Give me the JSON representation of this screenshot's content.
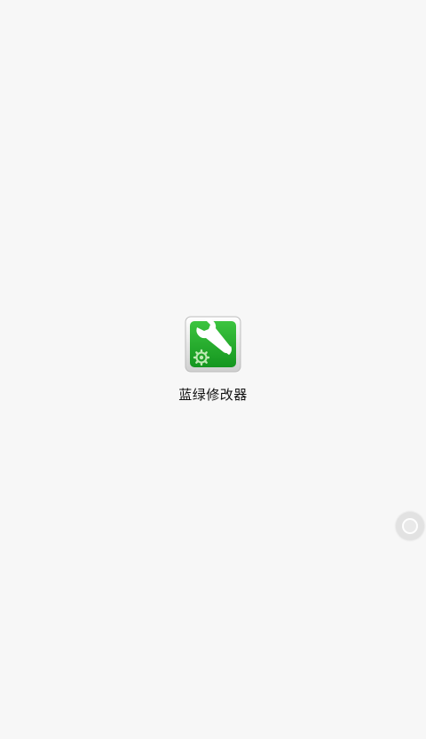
{
  "app": {
    "name": "蓝绿修改器",
    "icon": "wrench-gear-icon"
  },
  "floating_button": {
    "icon": "assistive-touch-icon"
  },
  "colors": {
    "background": "#f7f7f7",
    "icon_green": "#1fa62a",
    "icon_border": "#d9d9d9"
  }
}
